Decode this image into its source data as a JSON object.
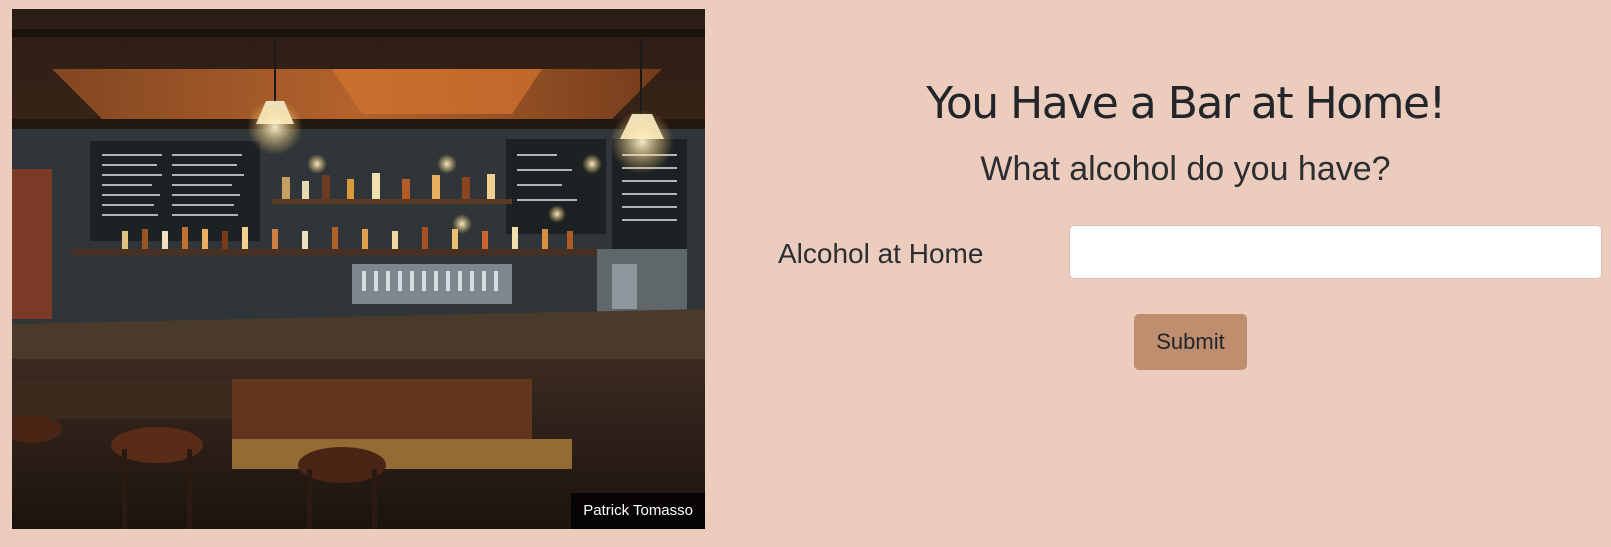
{
  "hero": {
    "image_subject": "bar interior with stools, shelves of bottles and chalkboard menus",
    "credit": "Patrick Tomasso"
  },
  "main": {
    "title": "You Have a Bar at Home!",
    "subtitle": "What alcohol do you have?",
    "form": {
      "label": "Alcohol at Home",
      "input_value": "",
      "input_placeholder": "",
      "submit_label": "Submit"
    }
  },
  "colors": {
    "background": "#ecccbd",
    "button": "#bf8e6f",
    "text": "#22252a"
  }
}
